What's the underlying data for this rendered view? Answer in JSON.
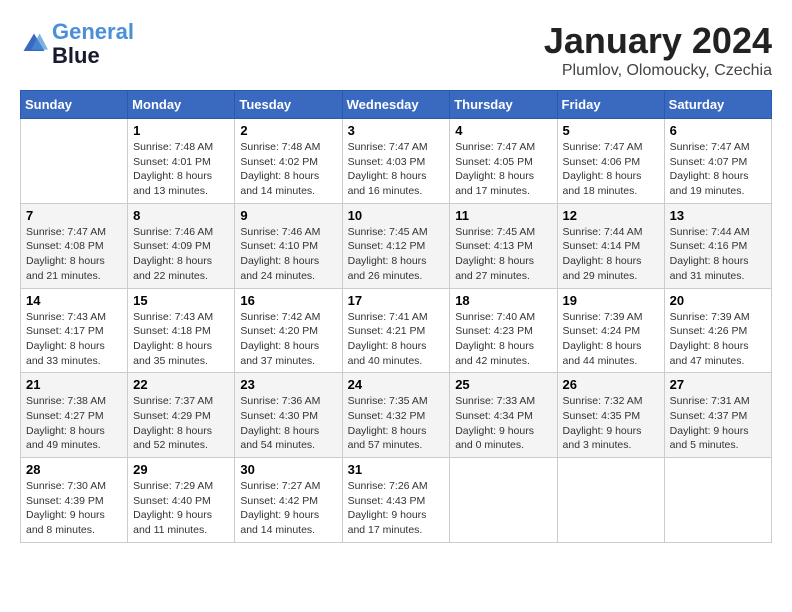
{
  "header": {
    "logo_line1": "General",
    "logo_line2": "Blue",
    "month_title": "January 2024",
    "subtitle": "Plumlov, Olomoucky, Czechia"
  },
  "days_of_week": [
    "Sunday",
    "Monday",
    "Tuesday",
    "Wednesday",
    "Thursday",
    "Friday",
    "Saturday"
  ],
  "weeks": [
    [
      {
        "day": "",
        "info": ""
      },
      {
        "day": "1",
        "info": "Sunrise: 7:48 AM\nSunset: 4:01 PM\nDaylight: 8 hours\nand 13 minutes."
      },
      {
        "day": "2",
        "info": "Sunrise: 7:48 AM\nSunset: 4:02 PM\nDaylight: 8 hours\nand 14 minutes."
      },
      {
        "day": "3",
        "info": "Sunrise: 7:47 AM\nSunset: 4:03 PM\nDaylight: 8 hours\nand 16 minutes."
      },
      {
        "day": "4",
        "info": "Sunrise: 7:47 AM\nSunset: 4:05 PM\nDaylight: 8 hours\nand 17 minutes."
      },
      {
        "day": "5",
        "info": "Sunrise: 7:47 AM\nSunset: 4:06 PM\nDaylight: 8 hours\nand 18 minutes."
      },
      {
        "day": "6",
        "info": "Sunrise: 7:47 AM\nSunset: 4:07 PM\nDaylight: 8 hours\nand 19 minutes."
      }
    ],
    [
      {
        "day": "7",
        "info": "Sunrise: 7:47 AM\nSunset: 4:08 PM\nDaylight: 8 hours\nand 21 minutes."
      },
      {
        "day": "8",
        "info": "Sunrise: 7:46 AM\nSunset: 4:09 PM\nDaylight: 8 hours\nand 22 minutes."
      },
      {
        "day": "9",
        "info": "Sunrise: 7:46 AM\nSunset: 4:10 PM\nDaylight: 8 hours\nand 24 minutes."
      },
      {
        "day": "10",
        "info": "Sunrise: 7:45 AM\nSunset: 4:12 PM\nDaylight: 8 hours\nand 26 minutes."
      },
      {
        "day": "11",
        "info": "Sunrise: 7:45 AM\nSunset: 4:13 PM\nDaylight: 8 hours\nand 27 minutes."
      },
      {
        "day": "12",
        "info": "Sunrise: 7:44 AM\nSunset: 4:14 PM\nDaylight: 8 hours\nand 29 minutes."
      },
      {
        "day": "13",
        "info": "Sunrise: 7:44 AM\nSunset: 4:16 PM\nDaylight: 8 hours\nand 31 minutes."
      }
    ],
    [
      {
        "day": "14",
        "info": "Sunrise: 7:43 AM\nSunset: 4:17 PM\nDaylight: 8 hours\nand 33 minutes."
      },
      {
        "day": "15",
        "info": "Sunrise: 7:43 AM\nSunset: 4:18 PM\nDaylight: 8 hours\nand 35 minutes."
      },
      {
        "day": "16",
        "info": "Sunrise: 7:42 AM\nSunset: 4:20 PM\nDaylight: 8 hours\nand 37 minutes."
      },
      {
        "day": "17",
        "info": "Sunrise: 7:41 AM\nSunset: 4:21 PM\nDaylight: 8 hours\nand 40 minutes."
      },
      {
        "day": "18",
        "info": "Sunrise: 7:40 AM\nSunset: 4:23 PM\nDaylight: 8 hours\nand 42 minutes."
      },
      {
        "day": "19",
        "info": "Sunrise: 7:39 AM\nSunset: 4:24 PM\nDaylight: 8 hours\nand 44 minutes."
      },
      {
        "day": "20",
        "info": "Sunrise: 7:39 AM\nSunset: 4:26 PM\nDaylight: 8 hours\nand 47 minutes."
      }
    ],
    [
      {
        "day": "21",
        "info": "Sunrise: 7:38 AM\nSunset: 4:27 PM\nDaylight: 8 hours\nand 49 minutes."
      },
      {
        "day": "22",
        "info": "Sunrise: 7:37 AM\nSunset: 4:29 PM\nDaylight: 8 hours\nand 52 minutes."
      },
      {
        "day": "23",
        "info": "Sunrise: 7:36 AM\nSunset: 4:30 PM\nDaylight: 8 hours\nand 54 minutes."
      },
      {
        "day": "24",
        "info": "Sunrise: 7:35 AM\nSunset: 4:32 PM\nDaylight: 8 hours\nand 57 minutes."
      },
      {
        "day": "25",
        "info": "Sunrise: 7:33 AM\nSunset: 4:34 PM\nDaylight: 9 hours\nand 0 minutes."
      },
      {
        "day": "26",
        "info": "Sunrise: 7:32 AM\nSunset: 4:35 PM\nDaylight: 9 hours\nand 3 minutes."
      },
      {
        "day": "27",
        "info": "Sunrise: 7:31 AM\nSunset: 4:37 PM\nDaylight: 9 hours\nand 5 minutes."
      }
    ],
    [
      {
        "day": "28",
        "info": "Sunrise: 7:30 AM\nSunset: 4:39 PM\nDaylight: 9 hours\nand 8 minutes."
      },
      {
        "day": "29",
        "info": "Sunrise: 7:29 AM\nSunset: 4:40 PM\nDaylight: 9 hours\nand 11 minutes."
      },
      {
        "day": "30",
        "info": "Sunrise: 7:27 AM\nSunset: 4:42 PM\nDaylight: 9 hours\nand 14 minutes."
      },
      {
        "day": "31",
        "info": "Sunrise: 7:26 AM\nSunset: 4:43 PM\nDaylight: 9 hours\nand 17 minutes."
      },
      {
        "day": "",
        "info": ""
      },
      {
        "day": "",
        "info": ""
      },
      {
        "day": "",
        "info": ""
      }
    ]
  ]
}
